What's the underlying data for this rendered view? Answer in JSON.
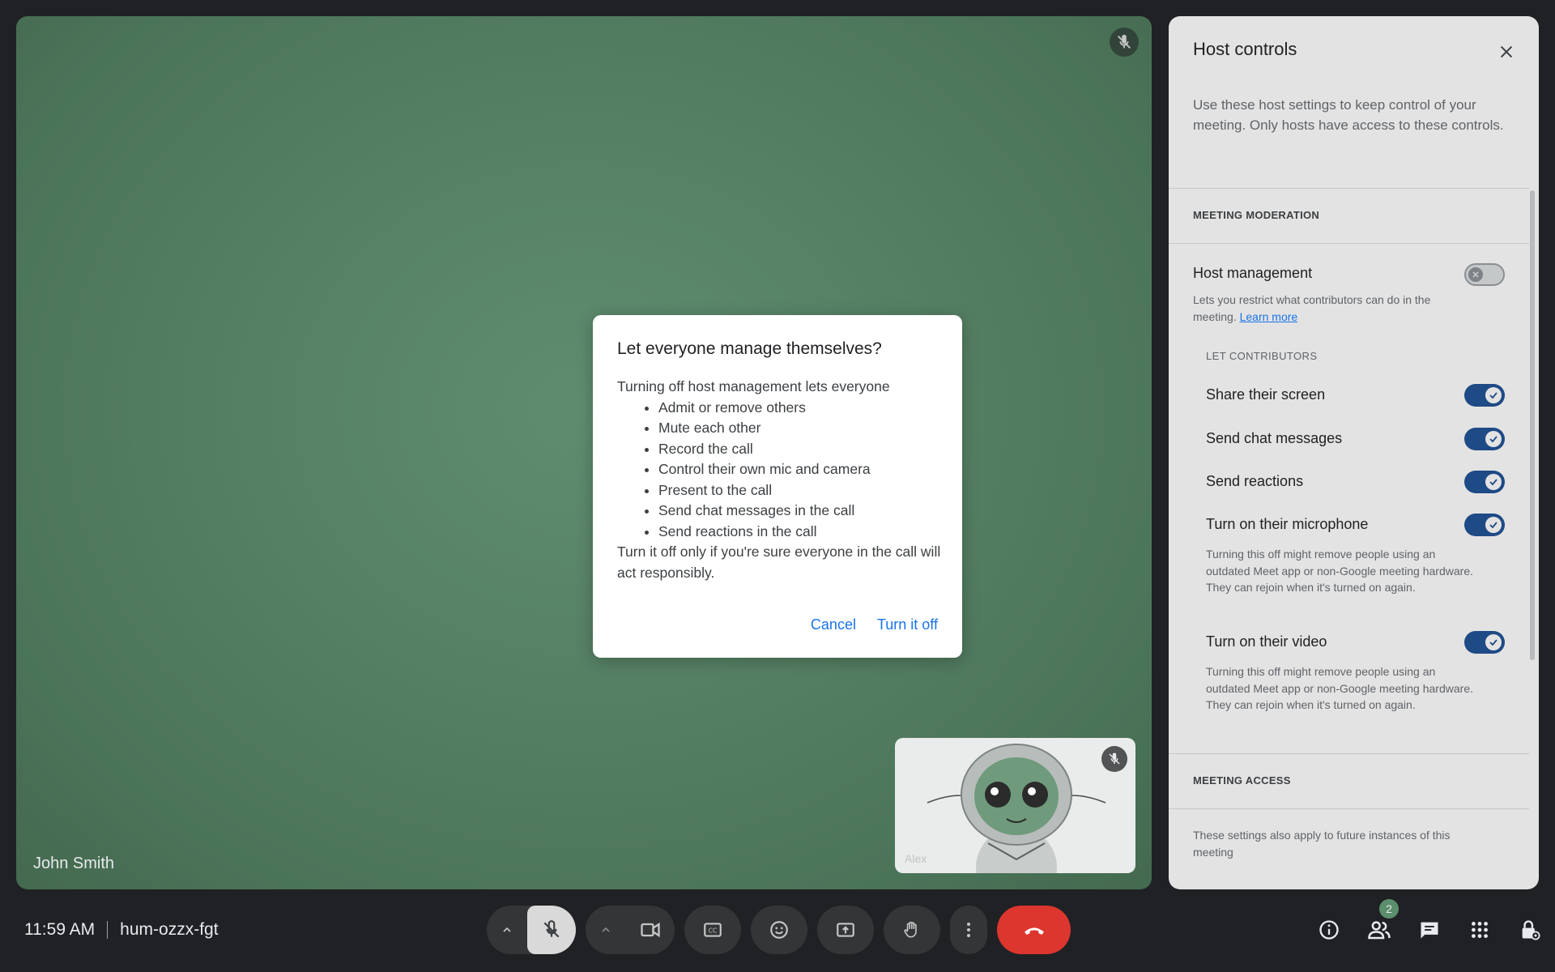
{
  "stage": {
    "participant_name": "John Smith"
  },
  "self_view": {
    "name": "Alex"
  },
  "dialog": {
    "title": "Let everyone manage themselves?",
    "intro": "Turning off host management lets everyone",
    "items": [
      "Admit or remove others",
      "Mute each other",
      "Record the call",
      "Control their own mic and camera",
      "Present to the call",
      "Send chat messages in the call",
      "Send reactions in the call"
    ],
    "outro": "Turn it off only if you're sure everyone in the call will act responsibly.",
    "cancel_label": "Cancel",
    "confirm_label": "Turn it off"
  },
  "panel": {
    "title": "Host controls",
    "intro": "Use these host settings to keep control of your meeting. Only hosts have access to these controls.",
    "moderation_title": "MEETING MODERATION",
    "host_management": {
      "label": "Host management",
      "desc": "Lets you restrict what contributors can do in the meeting.",
      "learn_more": "Learn more",
      "state": "off"
    },
    "let_contributors": "LET CONTRIBUTORS",
    "settings": [
      {
        "label": "Share their screen",
        "state": "on"
      },
      {
        "label": "Send chat messages",
        "state": "on"
      },
      {
        "label": "Send reactions",
        "state": "on"
      },
      {
        "label": "Turn on their microphone",
        "state": "on",
        "desc": "Turning this off might remove people using an outdated Meet app or non-Google meeting hardware. They can rejoin when it's turned on again."
      },
      {
        "label": "Turn on their video",
        "state": "on",
        "desc": "Turning this off might remove people using an outdated Meet app or non-Google meeting hardware. They can rejoin when it's turned on again."
      }
    ],
    "access_title": "MEETING ACCESS",
    "access_desc": "These settings also apply to future instances of this meeting"
  },
  "bottom": {
    "time": "11:59 AM",
    "meeting_code": "hum-ozzx-fgt",
    "people_count": "2",
    "end_call_color": "#dc362e"
  },
  "colors": {
    "accent": "#1a73e8",
    "toggle_on": "#1e4a85",
    "stage_bg": "#557f63"
  }
}
